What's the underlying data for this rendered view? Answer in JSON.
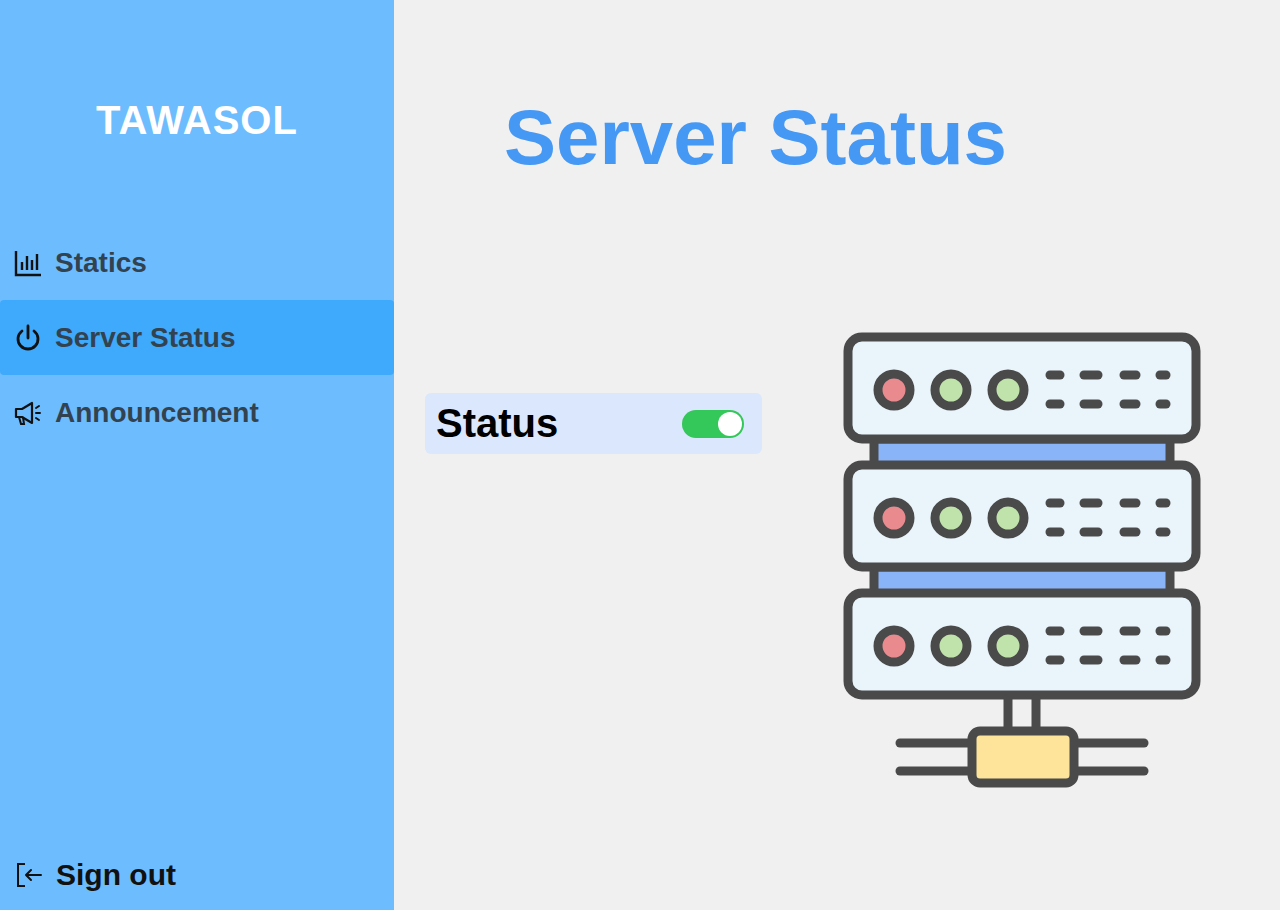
{
  "app": {
    "logo": "TAWASOL"
  },
  "sidebar": {
    "items": [
      {
        "label": "Statics",
        "selected": false
      },
      {
        "label": "Server Status",
        "selected": true
      },
      {
        "label": "Announcement",
        "selected": false
      }
    ],
    "sign_out": "Sign out"
  },
  "page": {
    "title": "Server Status"
  },
  "status": {
    "label": "Status",
    "on": true
  }
}
